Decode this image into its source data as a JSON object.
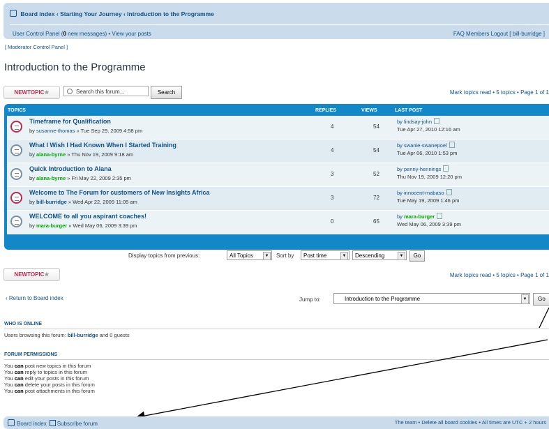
{
  "nav": {
    "breadcrumbs": [
      "Board index",
      "Starting Your Journey",
      "Introduction to the Programme"
    ],
    "ucp": "User Control Panel (",
    "new_messages": "0",
    "ucp_tail": " new messages) • View your posts",
    "right_links": "FAQ  Members  Logout [ bill-burridge ]"
  },
  "mcp": "[ Moderator Control Panel ]",
  "page_title": "Introduction to the Programme",
  "new_topic_label": "NEWTOPIC",
  "search": {
    "placeholder": "Search this forum...",
    "button": "Search"
  },
  "pagination_top": "Mark topics read • 5 topics • Page 1 of 1",
  "pagination_bottom": "Mark topics read • 5 topics • Page 1 of 1",
  "table": {
    "headers": {
      "topics": "TOPICS",
      "replies": "REPLIES",
      "views": "VIEWS",
      "last_post": "LAST POST"
    },
    "rows": [
      {
        "title": "Timeframe for Qualification",
        "by": "by ",
        "author": "susanne-thomas",
        "date": " » Tue Sep 29, 2009 4:58 pm",
        "replies": "4",
        "views": "54",
        "lp_by": "by lindsay-john",
        "lp_date": "Tue Apr 27, 2010 12:16 am"
      },
      {
        "title": "What I Wish I Had Known When I Started Training",
        "by": "by ",
        "author": "alana-byrne",
        "date": " » Thu Nov 19, 2009 9:18 am",
        "replies": "4",
        "views": "54",
        "lp_by": "by swanie-swanepoel",
        "lp_date": "Tue Apr 06, 2010 1:53 pm"
      },
      {
        "title": "Quick Introduction to Alana",
        "by": "by ",
        "author": "alana-byrne",
        "date": " » Fri May 22, 2009 2:35 pm",
        "replies": "3",
        "views": "52",
        "lp_by": "by penny-hennings",
        "lp_date": "Thu Nov 19, 2009 12:20 pm"
      },
      {
        "title": "Welcome to The Forum for customers of New Insights Africa",
        "by": "by ",
        "author": "bill-burridge",
        "date": " » Wed Apr 22, 2009 11:05 am",
        "replies": "3",
        "views": "72",
        "lp_by": "by innocent-mabaso",
        "lp_date": "Tue May 19, 2009 1:46 pm"
      },
      {
        "title": "WELCOME to all you aspirant coaches!",
        "by": "by ",
        "author": "mara-burger",
        "date": " » Wed May 06, 2009 3:39 pm",
        "replies": "0",
        "views": "65",
        "lp_by_prefix": "by ",
        "lp_by_name": "mara-burger",
        "lp_date": "Wed May 06, 2009 3:39 pm"
      }
    ]
  },
  "display": {
    "label": "Display topics from previous:",
    "topics_value": "All Topics",
    "sort_label": "Sort by",
    "sort_value": "Post time",
    "order_value": "Descending",
    "go": "Go"
  },
  "return_link": "‹ Return to Board index",
  "jump": {
    "label": "Jump to:",
    "value": "Introduction to the Programme",
    "go": "Go"
  },
  "who_online": {
    "heading": "WHO IS ONLINE",
    "text_pre": "Users browsing this forum: ",
    "user": "bill-burridge",
    "text_post": " and 0 guests"
  },
  "permissions": {
    "heading": "FORUM PERMISSIONS",
    "lines": [
      {
        "pre": "You ",
        "can": "can",
        "post": " post new topics in this forum"
      },
      {
        "pre": "You ",
        "can": "can",
        "post": " reply to topics in this forum"
      },
      {
        "pre": "You ",
        "can": "can",
        "post": " edit your posts in this forum"
      },
      {
        "pre": "You ",
        "can": "can",
        "post": " delete your posts in this forum"
      },
      {
        "pre": "You ",
        "can": "can",
        "post": " post attachments in this forum"
      }
    ]
  },
  "footer": {
    "board_index": "Board index",
    "subscribe": "Subscribe forum",
    "right": "The team • Delete all board cookies • All times are UTC + 2 hours"
  }
}
